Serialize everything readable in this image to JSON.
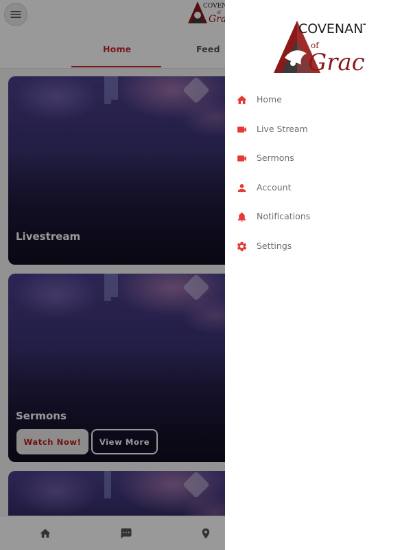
{
  "app": {
    "tabs": [
      {
        "label": "Home",
        "active": true
      },
      {
        "label": "Feed",
        "active": false
      }
    ],
    "cards": [
      {
        "title": "Livestream"
      },
      {
        "title": "Sermons",
        "primary_button": "Watch Now!",
        "secondary_button": "View More"
      },
      {
        "title": ""
      }
    ],
    "bottom_nav": [
      {
        "icon": "home-icon"
      },
      {
        "icon": "chat-icon"
      },
      {
        "icon": "location-icon"
      }
    ]
  },
  "logo": {
    "line1": "COVENANT",
    "line2": "of",
    "line3": "Grace"
  },
  "drawer": {
    "items": [
      {
        "label": "Home",
        "icon": "home-icon"
      },
      {
        "label": "Live Stream",
        "icon": "video-camera-icon"
      },
      {
        "label": "Sermons",
        "icon": "video-camera-icon"
      },
      {
        "label": "Account",
        "icon": "person-icon"
      },
      {
        "label": "Notifications",
        "icon": "bell-icon"
      },
      {
        "label": "Settings",
        "icon": "gear-icon"
      }
    ]
  },
  "colors": {
    "accent": "#c62828",
    "drawer_icon": "#e53935",
    "drawer_text": "#6f6f6f"
  }
}
